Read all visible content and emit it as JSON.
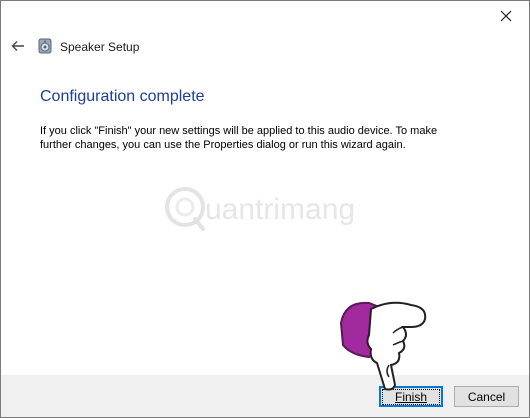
{
  "window": {
    "title": "Speaker Setup",
    "close_icon": "close-icon",
    "back_icon": "back-arrow-icon",
    "app_icon": "speaker-setup-icon"
  },
  "content": {
    "heading": "Configuration complete",
    "body": "If you click \"Finish\" your new settings will be applied to this audio device.  To make further changes, you can use the Properties dialog or run this wizard again."
  },
  "watermark": {
    "text": "uantrimang"
  },
  "footer": {
    "finish_label": "Finish",
    "cancel_label": "Cancel"
  },
  "colors": {
    "heading": "#1e3e9a",
    "focus_border": "#0078d7",
    "footer_bg": "#f0f0f0",
    "hand": "#a12a9f"
  }
}
